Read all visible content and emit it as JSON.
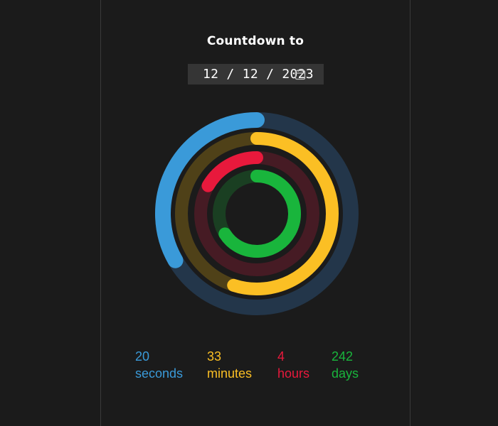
{
  "header": {
    "title": "Countdown to"
  },
  "date_input": {
    "value": "12 / 12 / 2023",
    "icon": "calendar-icon"
  },
  "colors": {
    "background": "#1b1b1b",
    "seconds": "#3a9ad9",
    "minutes": "#fbbf24",
    "hours": "#e8193c",
    "days": "#19b53c"
  },
  "counters": {
    "seconds": {
      "value": "20",
      "label": "seconds",
      "progress": 0.333
    },
    "minutes": {
      "value": "33",
      "label": "minutes",
      "progress": 0.55
    },
    "hours": {
      "value": "4",
      "label": "hours",
      "progress": 0.167
    },
    "days": {
      "value": "242",
      "label": "days",
      "progress": 0.66
    }
  }
}
